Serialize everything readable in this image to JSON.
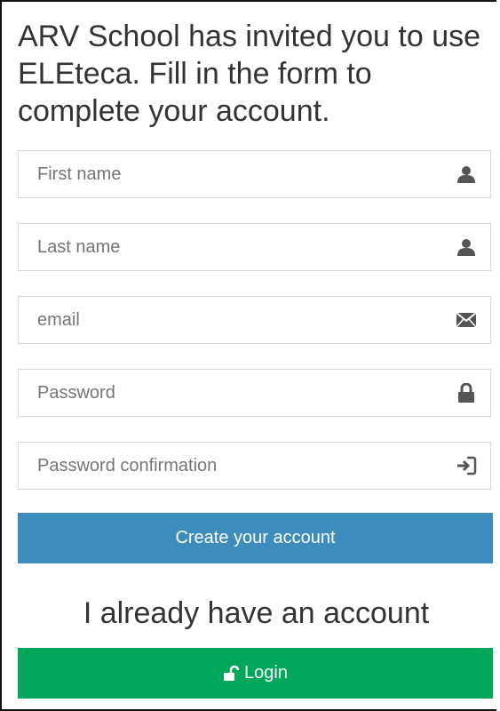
{
  "heading": "ARV School has invited you to use ELEteca. Fill in the form to complete your account.",
  "form": {
    "first_name": {
      "placeholder": "First name",
      "value": "",
      "icon": "user-icon"
    },
    "last_name": {
      "placeholder": "Last name",
      "value": "",
      "icon": "user-icon"
    },
    "email": {
      "placeholder": "email",
      "value": "",
      "icon": "envelope-icon"
    },
    "password": {
      "placeholder": "Password",
      "value": "",
      "icon": "lock-icon"
    },
    "password_confirmation": {
      "placeholder": "Password confirmation",
      "value": "",
      "icon": "log-in-icon"
    }
  },
  "buttons": {
    "create_account": "Create your account",
    "login": "Login"
  },
  "already_text": "I already have an account",
  "colors": {
    "primary": "#3c8dbc",
    "success": "#00a65a",
    "input_border": "#d2d6de",
    "text": "#333333",
    "placeholder": "#757575",
    "icon": "#555555"
  }
}
